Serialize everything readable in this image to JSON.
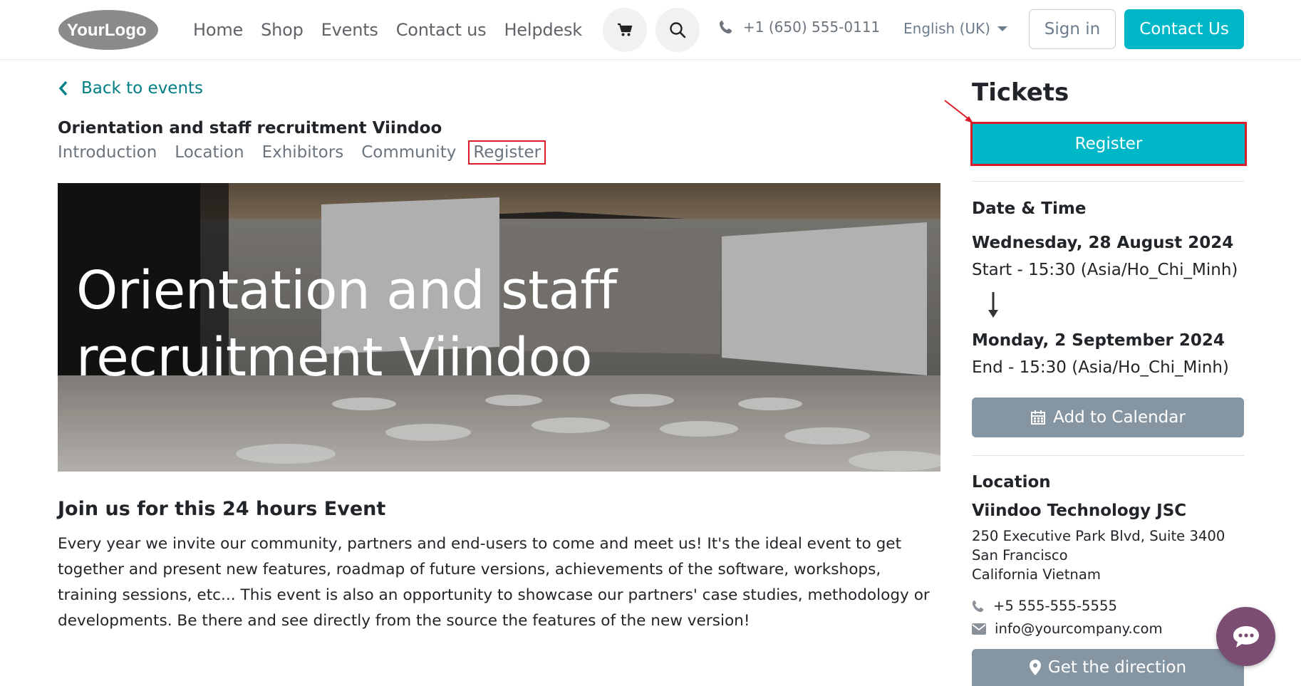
{
  "header": {
    "logo_text": "YourLogo",
    "nav": [
      "Home",
      "Shop",
      "Events",
      "Contact us",
      "Helpdesk"
    ],
    "phone": "+1 (650) 555-0111",
    "language": "English (UK)",
    "sign_in": "Sign in",
    "contact_us": "Contact Us"
  },
  "back_link": "Back to events",
  "event": {
    "title": "Orientation and staff recruitment Viindoo",
    "tabs": [
      "Introduction",
      "Location",
      "Exhibitors",
      "Community",
      "Register"
    ],
    "hero_title": "Orientation and staff recruitment Viindoo"
  },
  "content": {
    "heading": "Join us for this 24 hours Event",
    "paragraph": "Every year we invite our community, partners and end-users to come and meet us! It's the ideal event to get together and present new features, roadmap of future versions, achievements of the software, workshops, training sessions, etc... This event is also an opportunity to showcase our partners' case studies, methodology or developments. Be there and see directly from the source the features of the new version!"
  },
  "sidebar": {
    "tickets_title": "Tickets",
    "register_label": "Register",
    "datetime_title": "Date & Time",
    "start_date": "Wednesday, 28 August 2024",
    "start_time": "Start - 15:30 (Asia/Ho_Chi_Minh)",
    "end_date": "Monday, 2 September 2024",
    "end_time": "End - 15:30 (Asia/Ho_Chi_Minh)",
    "add_calendar": "Add to Calendar",
    "location_title": "Location",
    "company": "Viindoo Technology JSC",
    "address_line1": "250 Executive Park Blvd, Suite 3400",
    "address_line2": "San Francisco",
    "address_line3": "California Vietnam",
    "phone": "+5 555-555-5555",
    "email": "info@yourcompany.com",
    "directions": "Get the direction"
  },
  "colors": {
    "accent": "#00b7c8",
    "link": "#017e84",
    "annotation": "#d91e2a",
    "gray_button": "#8595a2",
    "chat": "#7c4d73"
  },
  "icons": [
    "cart-icon",
    "search-icon",
    "phone-icon",
    "chevron-left-icon",
    "calendar-icon",
    "map-marker-icon",
    "envelope-icon",
    "chat-icon"
  ]
}
